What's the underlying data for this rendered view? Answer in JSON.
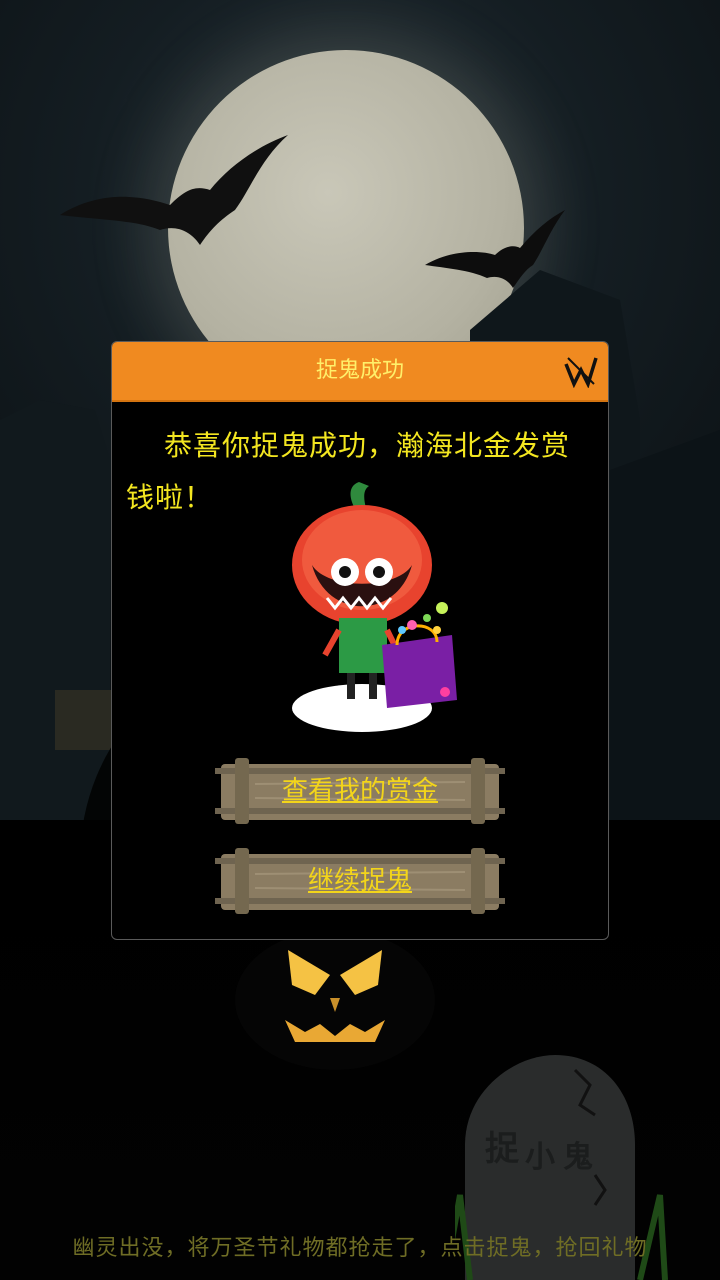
{
  "background": {
    "moon_color": "#b9b7a7",
    "footer_text": "幽灵出没，将万圣节礼物都抢走了，点击捉鬼，抢回礼物",
    "tombstone_text": "捉小鬼"
  },
  "modal": {
    "title": "捉鬼成功",
    "close_icon": "close-icon",
    "message": "恭喜你捉鬼成功，瀚海北金发赏钱啦！",
    "header_color": "#f08a20",
    "buttons": {
      "view_bounty": "查看我的赏金",
      "continue": "继续捉鬼"
    }
  }
}
